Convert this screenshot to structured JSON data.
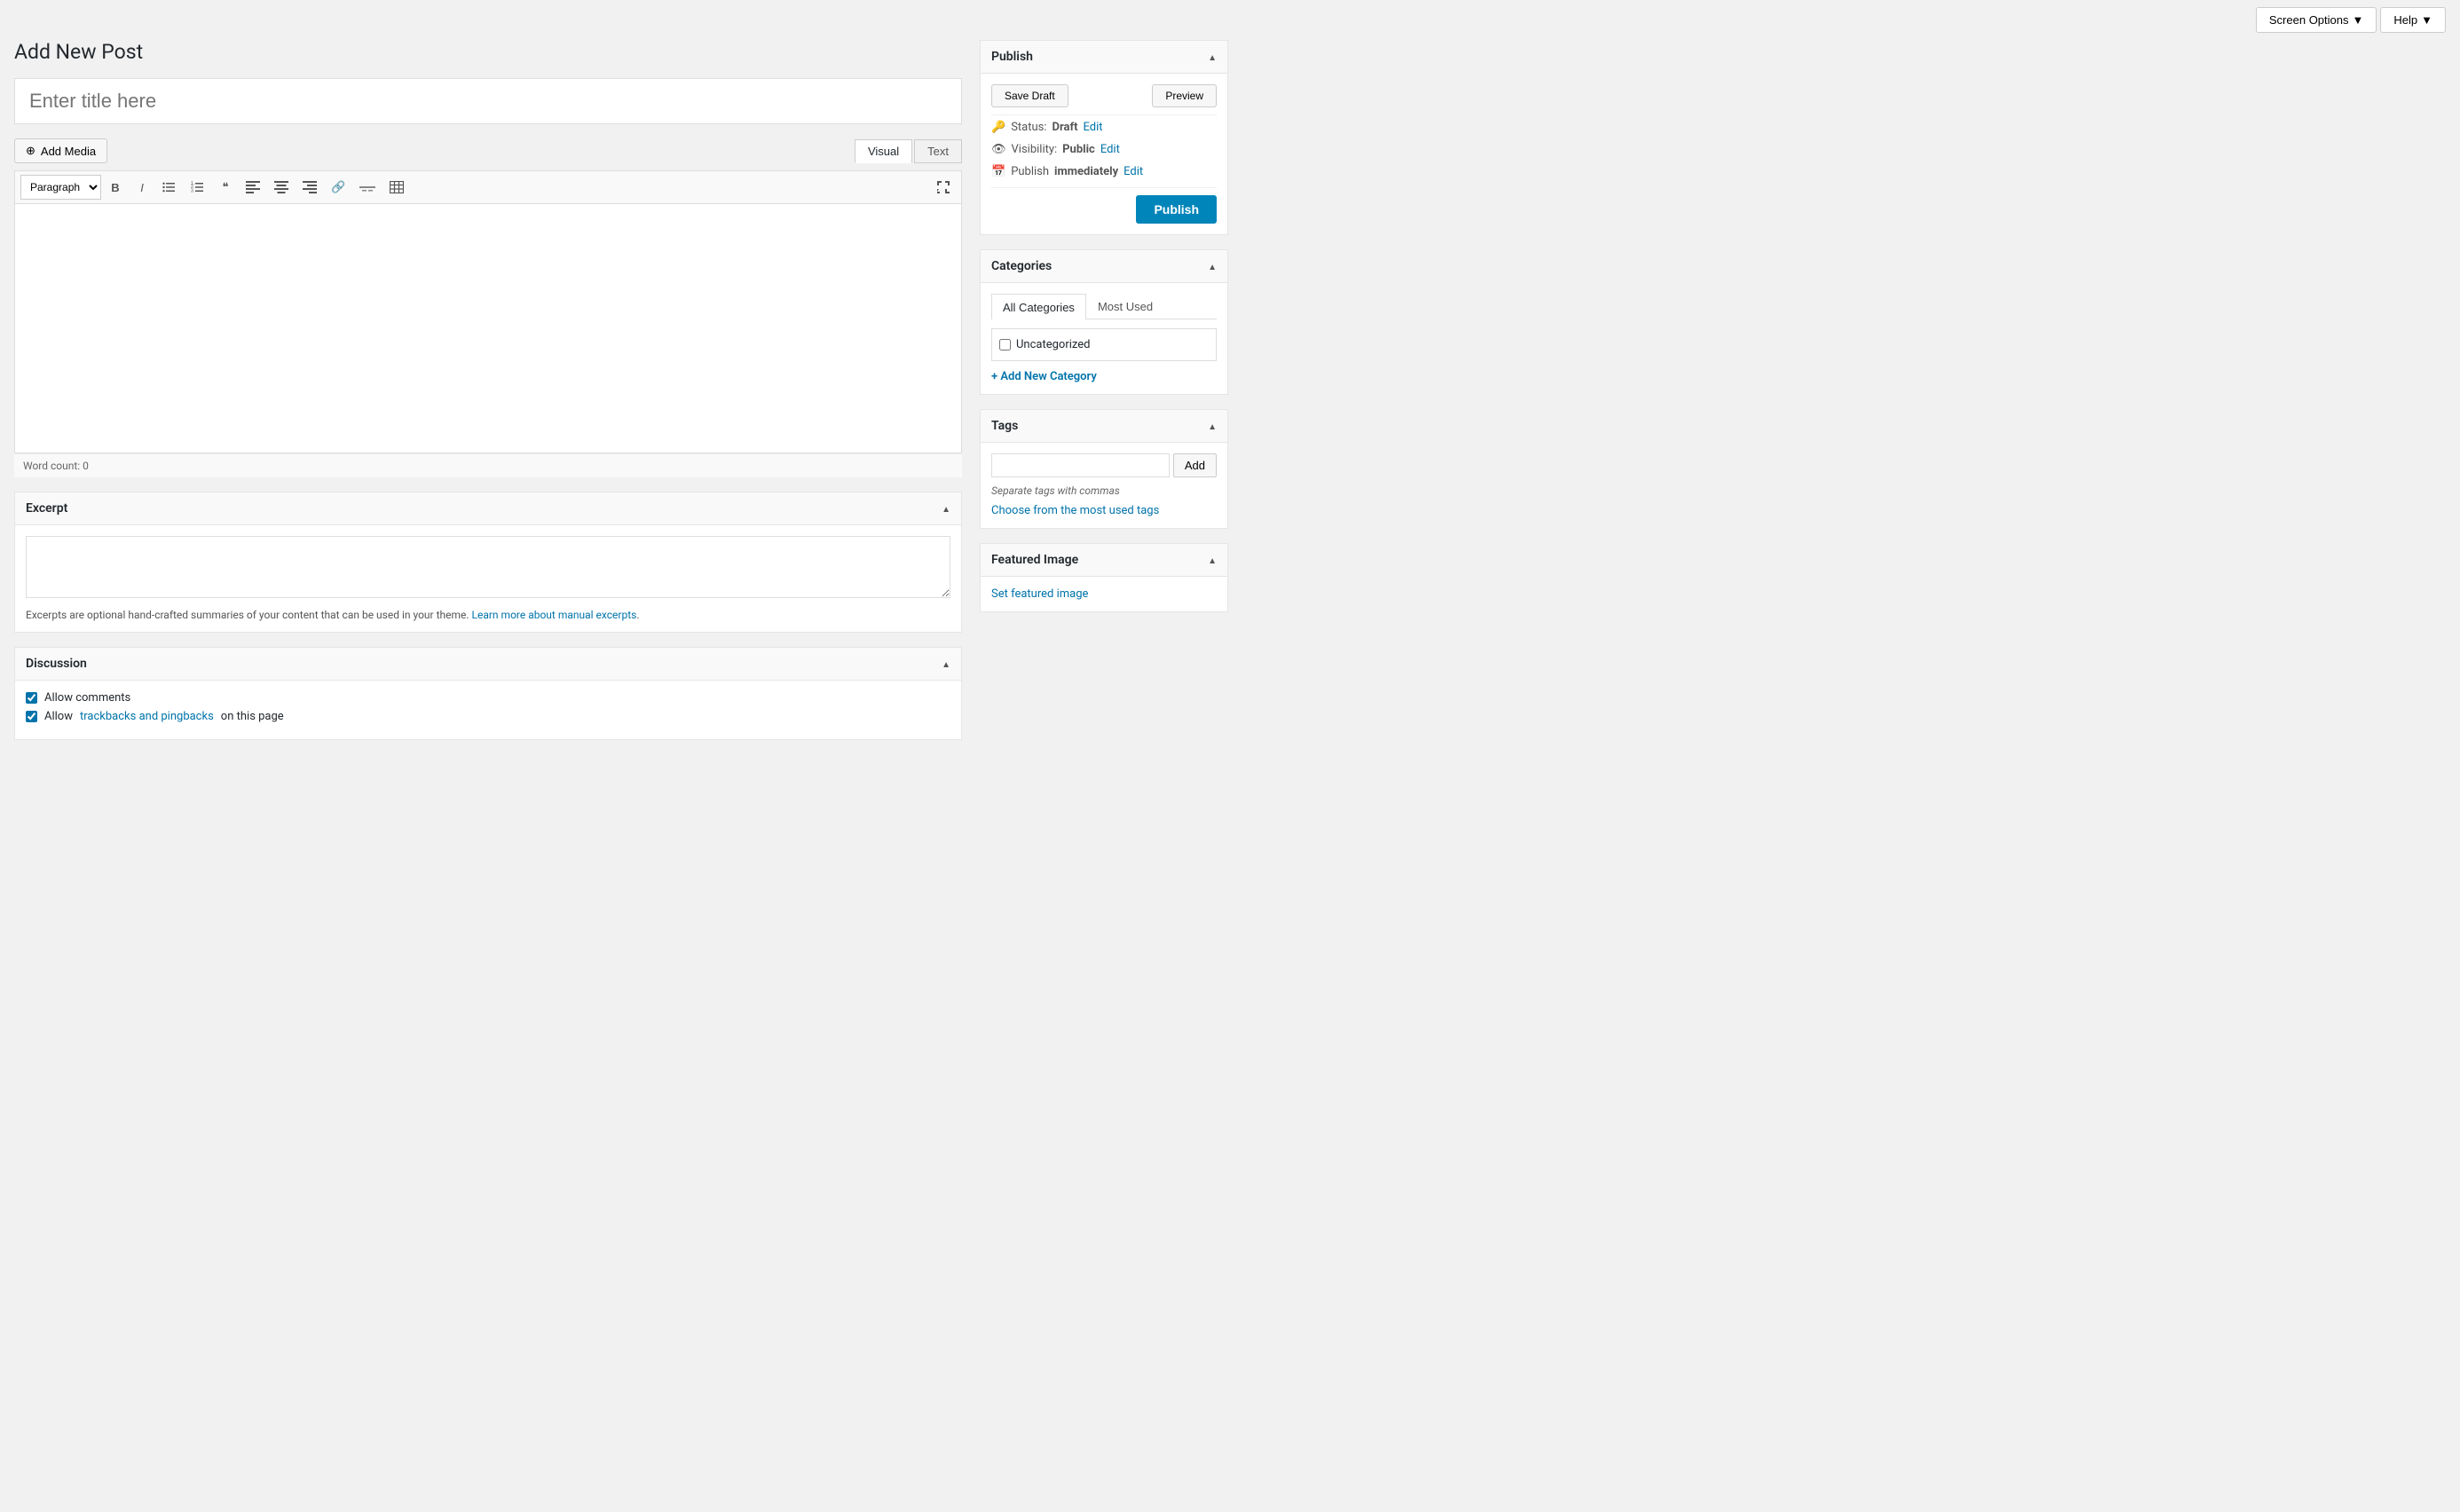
{
  "topbar": {
    "screen_options_label": "Screen Options",
    "help_label": "Help"
  },
  "page": {
    "title": "Add New Post"
  },
  "title_input": {
    "placeholder": "Enter title here"
  },
  "editor": {
    "add_media_label": "Add Media",
    "visual_tab": "Visual",
    "text_tab": "Text",
    "format_options": [
      "Paragraph"
    ],
    "word_count_label": "Word count: 0"
  },
  "excerpt": {
    "heading": "Excerpt",
    "note_text": "Excerpts are optional hand-crafted summaries of your content that can be used in your theme.",
    "learn_link_text": "Learn more about manual excerpts",
    "learn_link_href": "#"
  },
  "discussion": {
    "heading": "Discussion",
    "allow_comments_label": "Allow comments",
    "allow_trackbacks_label_prefix": "Allow",
    "allow_trackbacks_link_text": "trackbacks and pingbacks",
    "allow_trackbacks_label_suffix": "on this page"
  },
  "publish_box": {
    "heading": "Publish",
    "save_draft_label": "Save Draft",
    "preview_label": "Preview",
    "status_label": "Status:",
    "status_value": "Draft",
    "status_edit": "Edit",
    "visibility_label": "Visibility:",
    "visibility_value": "Public",
    "visibility_edit": "Edit",
    "publish_time_label": "Publish",
    "publish_time_value": "immediately",
    "publish_time_edit": "Edit",
    "publish_btn_label": "Publish"
  },
  "categories_box": {
    "heading": "Categories",
    "tab_all": "All Categories",
    "tab_most_used": "Most Used",
    "items": [
      {
        "label": "Uncategorized",
        "checked": false
      }
    ],
    "add_new_label": "+ Add New Category"
  },
  "tags_box": {
    "heading": "Tags",
    "input_placeholder": "",
    "add_btn_label": "Add",
    "hint_text": "Separate tags with commas",
    "choose_link_text": "Choose from the most used tags"
  },
  "featured_image_box": {
    "heading": "Featured Image",
    "set_link_text": "Set featured image"
  },
  "icons": {
    "add_media": "⊕",
    "bold": "B",
    "italic": "I",
    "ul": "≡",
    "ol": "≡",
    "blockquote": "❝",
    "align_left": "≡",
    "align_center": "≡",
    "align_right": "≡",
    "link": "🔗",
    "more": "—",
    "fullscreen": "⛶",
    "status_icon": "🔑",
    "visibility_icon": "👁",
    "publish_icon": "📅"
  }
}
